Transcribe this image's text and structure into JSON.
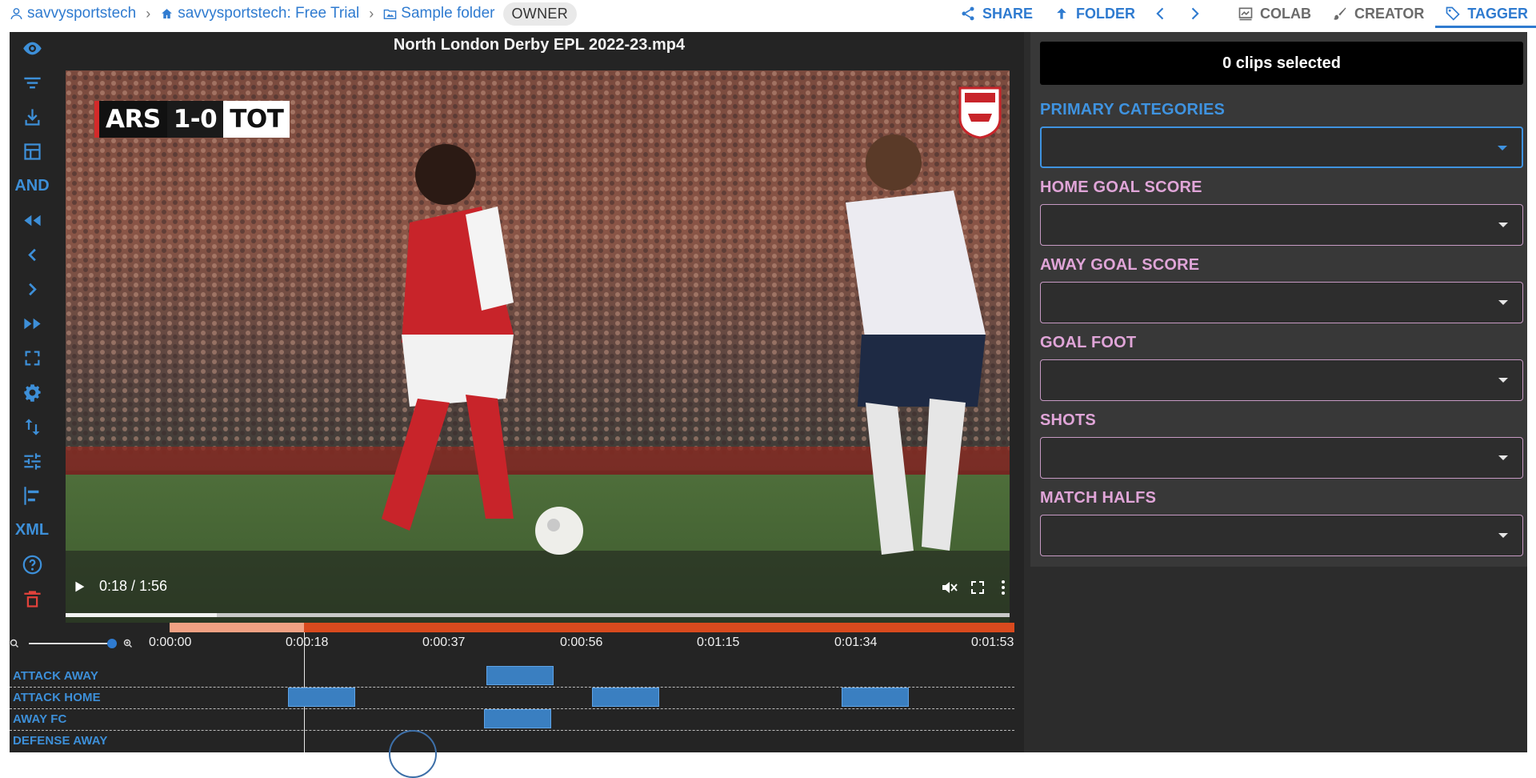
{
  "breadcrumb": {
    "user": "savvysportstech",
    "workspace": "savvysportstech: Free Trial",
    "folder": "Sample folder",
    "role_badge": "OWNER"
  },
  "toolbar": {
    "share": "SHARE",
    "folder": "FOLDER",
    "colab": "COLAB",
    "creator": "CREATOR",
    "tagger": "TAGGER",
    "accent": "#2f7bd0"
  },
  "rail": {
    "and_label": "AND",
    "xml_label": "XML",
    "icons": [
      "eye-icon",
      "filter-icon",
      "download-icon",
      "table-icon",
      "rewind-icon",
      "chevron-left-icon",
      "chevron-right-icon",
      "fast-forward-icon",
      "fullscreen-icon",
      "gear-icon",
      "sort-icon",
      "tune-icon",
      "align-icon",
      "help-icon",
      "trash-icon"
    ]
  },
  "video": {
    "title": "North London Derby EPL 2022-23.mp4",
    "score": {
      "home": "ARS",
      "result": "1-0",
      "away": "TOT"
    },
    "time": "0:18 / 1:56",
    "progress": 0.16
  },
  "timeline": {
    "ticks": [
      "0:00:00",
      "0:00:18",
      "0:00:37",
      "0:00:56",
      "0:01:15",
      "0:01:34",
      "0:01:53"
    ],
    "rows": [
      {
        "label": "ATTACK AWAY",
        "clips": [
          [
            0.375,
            0.455
          ]
        ]
      },
      {
        "label": "ATTACK HOME",
        "clips": [
          [
            0.14,
            0.22
          ],
          [
            0.5,
            0.58
          ],
          [
            0.795,
            0.875
          ]
        ]
      },
      {
        "label": "AWAY FC",
        "clips": [
          [
            0.372,
            0.452
          ]
        ]
      },
      {
        "label": "DEFENSE AWAY",
        "clips": []
      }
    ]
  },
  "panel": {
    "clips_selected": "0 clips selected",
    "fields": [
      {
        "label": "PRIMARY CATEGORIES",
        "value": ""
      },
      {
        "label": "HOME GOAL SCORE",
        "value": ""
      },
      {
        "label": "AWAY GOAL SCORE",
        "value": ""
      },
      {
        "label": "GOAL FOOT",
        "value": ""
      },
      {
        "label": "SHOTS",
        "value": ""
      },
      {
        "label": "MATCH HALFS",
        "value": ""
      }
    ]
  }
}
